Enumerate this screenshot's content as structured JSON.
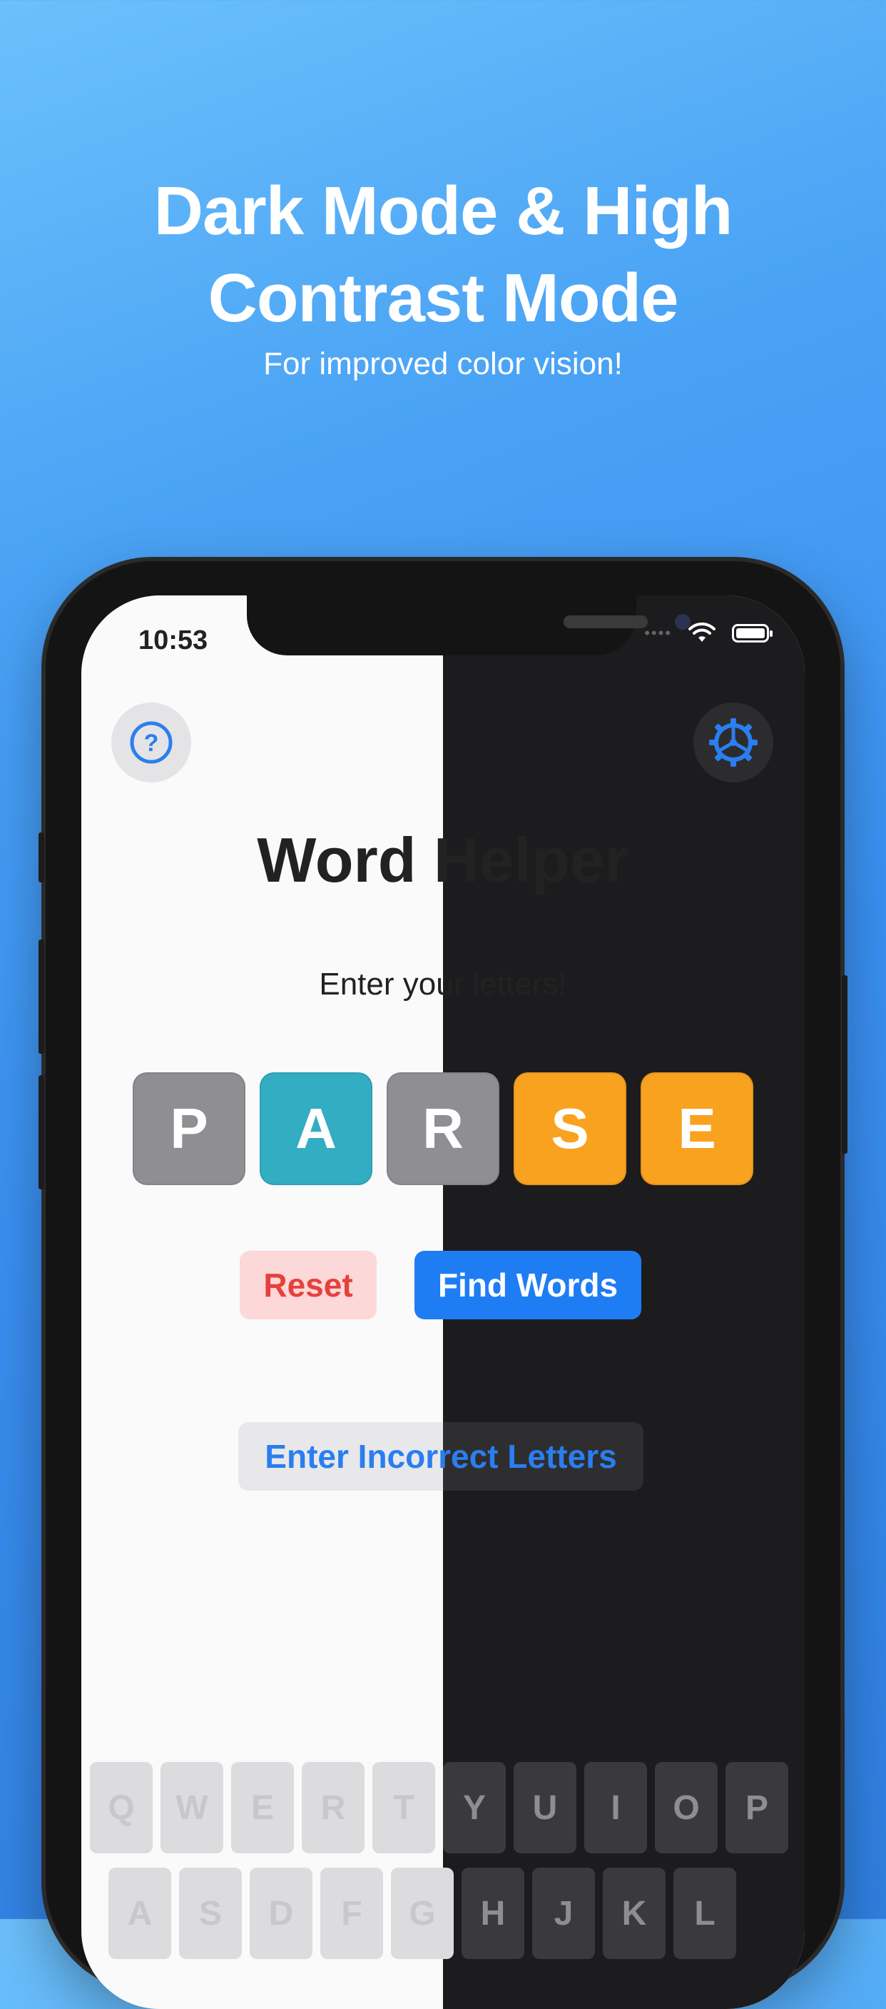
{
  "marketing": {
    "headline_line1": "Dark Mode & High",
    "headline_line2": "Contrast Mode",
    "subheadline": "For improved color vision!"
  },
  "status_bar": {
    "time": "10:53"
  },
  "app": {
    "title": "Word Helper",
    "prompt": "Enter your letters!",
    "tiles": [
      {
        "letter": "P",
        "color": "#8e8e93"
      },
      {
        "letter": "A",
        "color": "#32adc2"
      },
      {
        "letter": "R",
        "color": "#8e8e93"
      },
      {
        "letter": "S",
        "color": "#f9a21f"
      },
      {
        "letter": "E",
        "color": "#f9a21f"
      }
    ],
    "reset_label": "Reset",
    "find_words_label": "Find Words",
    "incorrect_letters_label": "Enter Incorrect Letters"
  },
  "keyboard": {
    "row1": [
      "Q",
      "W",
      "E",
      "R",
      "T",
      "Y",
      "U",
      "I",
      "O",
      "P"
    ],
    "row2": [
      "A",
      "S",
      "D",
      "F",
      "G",
      "H",
      "J",
      "K",
      "L"
    ]
  },
  "colors": {
    "accent_blue": "#1f7df3",
    "reset_red": "#e6413c",
    "tile_gray": "#8e8e93",
    "tile_teal": "#32adc2",
    "tile_orange": "#f9a21f"
  },
  "icons": {
    "help": "question-circle-icon",
    "settings": "gear-icon"
  }
}
